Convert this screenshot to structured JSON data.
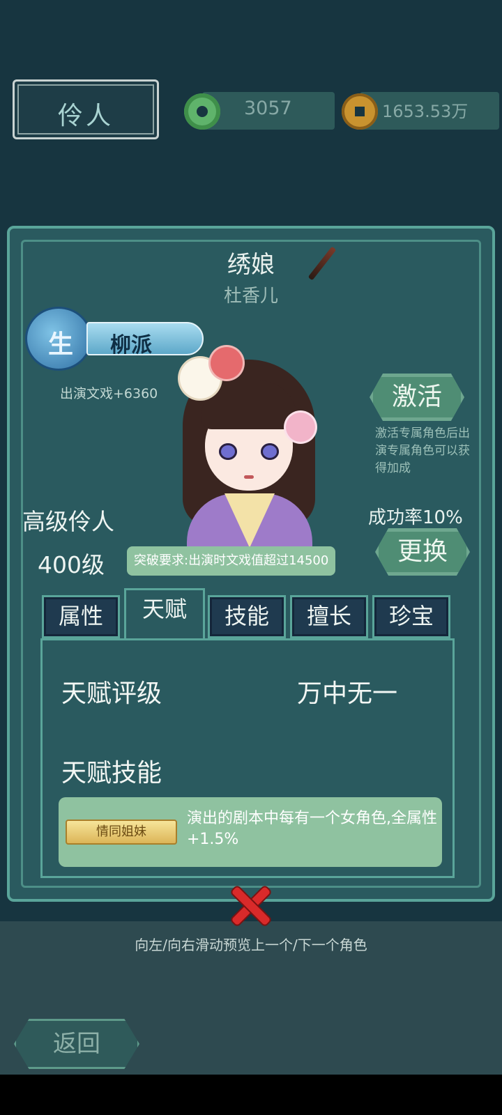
{
  "header": {
    "title": "伶人",
    "jade_amount": "3057",
    "coin_amount": "1653.53万"
  },
  "role": {
    "title": "绣娘",
    "name": "杜香儿",
    "faction_type": "生",
    "faction": "柳派",
    "perform_bonus": "出演文戏+6360",
    "rank": "高级伶人",
    "level": "400级",
    "breakthrough": "突破要求:出演时文戏值超过14500"
  },
  "actions": {
    "activate_label": "激活",
    "activate_note": "激活专属角色后出演专属角色可以获得加成",
    "success_rate": "成功率10%",
    "change_label": "更换"
  },
  "tabs": [
    {
      "label": "属性"
    },
    {
      "label": "天赋"
    },
    {
      "label": "技能"
    },
    {
      "label": "擅长"
    },
    {
      "label": "珍宝"
    }
  ],
  "active_tab": "天赋",
  "talent": {
    "rating_label": "天赋评级",
    "rating_value": "万中无一",
    "skill_label": "天赋技能",
    "skill_tag": "情同姐妹",
    "skill_desc": "演出的剧本中每有一个女角色,全属性+1.5%"
  },
  "footer": {
    "swipe_hint": "向左/向右滑动预览上一个/下一个角色",
    "back_label": "返回"
  },
  "colors": {
    "panel": "#2a5a5f",
    "border": "#5aa59a",
    "accent_green": "#8fc2a0",
    "close_red": "#d92a2a"
  }
}
